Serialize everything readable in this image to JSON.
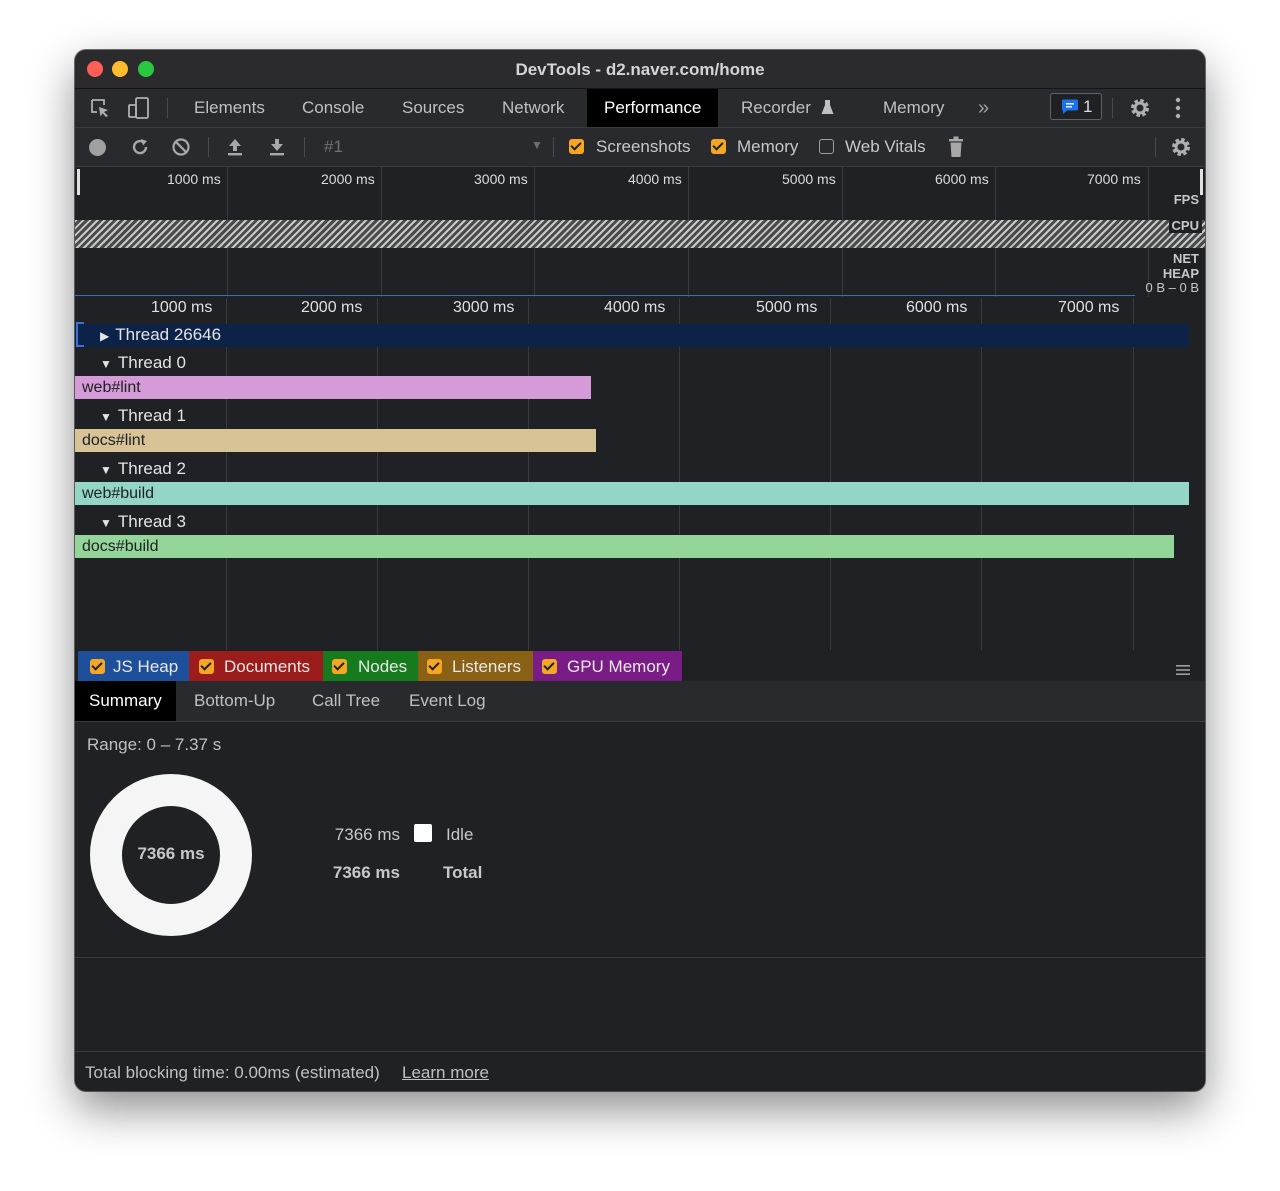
{
  "window": {
    "title": "DevTools - d2.naver.com/home"
  },
  "tabs": [
    "Elements",
    "Console",
    "Sources",
    "Network",
    "Performance",
    "Recorder",
    "Memory"
  ],
  "active_tab": "Performance",
  "overflow_chevron": "»",
  "issues_count": "1",
  "toolbar": {
    "profile_select": "#1",
    "checkboxes": [
      {
        "label": "Screenshots",
        "checked": true
      },
      {
        "label": "Memory",
        "checked": true
      },
      {
        "label": "Web Vitals",
        "checked": false
      }
    ]
  },
  "overview": {
    "ticks": [
      "1000 ms",
      "2000 ms",
      "3000 ms",
      "4000 ms",
      "5000 ms",
      "6000 ms",
      "7000 ms"
    ],
    "tracks": {
      "fps": "FPS",
      "cpu": "CPU",
      "net": "NET",
      "heap": "HEAP",
      "heap_range": "0 B – 0 B"
    }
  },
  "flame": {
    "ticks": [
      "1000 ms",
      "2000 ms",
      "3000 ms",
      "4000 ms",
      "5000 ms",
      "6000 ms",
      "7000 ms"
    ],
    "threads": [
      {
        "name": "Thread 26646",
        "expanded": false
      },
      {
        "name": "Thread 0",
        "expanded": true,
        "task": "web#lint",
        "color": "#d59bd8"
      },
      {
        "name": "Thread 1",
        "expanded": true,
        "task": "docs#lint",
        "color": "#d8c397"
      },
      {
        "name": "Thread 2",
        "expanded": true,
        "task": "web#build",
        "color": "#93d5c6"
      },
      {
        "name": "Thread 3",
        "expanded": true,
        "task": "docs#build",
        "color": "#94d69a"
      }
    ]
  },
  "memory_legend": [
    {
      "label": "JS Heap",
      "color": "#1d4f9b"
    },
    {
      "label": "Documents",
      "color": "#9c1c1c"
    },
    {
      "label": "Nodes",
      "color": "#167b1d"
    },
    {
      "label": "Listeners",
      "color": "#8a6114"
    },
    {
      "label": "GPU Memory",
      "color": "#7a1c85"
    }
  ],
  "bottom_tabs": [
    "Summary",
    "Bottom-Up",
    "Call Tree",
    "Event Log"
  ],
  "summary": {
    "range": "Range: 0 – 7.37 s",
    "donut_center": "7366 ms",
    "idle_value": "7366 ms",
    "idle_label": "Idle",
    "total_value": "7366 ms",
    "total_label": "Total"
  },
  "footer": {
    "text": "Total blocking time: 0.00ms (estimated)",
    "link": "Learn more"
  }
}
